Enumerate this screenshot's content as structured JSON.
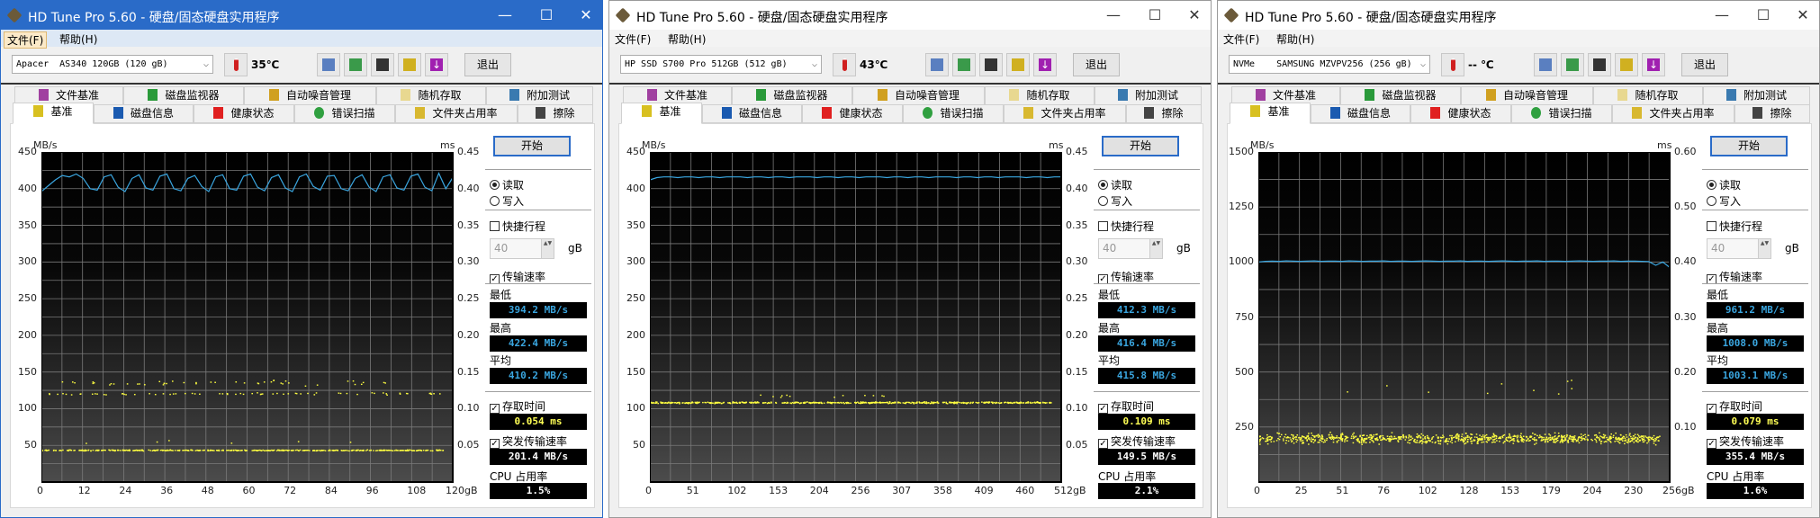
{
  "labels": {
    "menu": [
      "文件(F)",
      "帮助(H)"
    ],
    "exit": "退出",
    "tabs_row1": [
      "文件基准",
      "磁盘监视器",
      "自动噪音管理",
      "随机存取",
      "附加测试"
    ],
    "tabs_row2": [
      "基准",
      "磁盘信息",
      "健康状态",
      "错误扫描",
      "文件夹占用率",
      "擦除"
    ],
    "start": "开始",
    "read": "读取",
    "write": "写入",
    "short_stroke": "快捷行程",
    "short_stroke_value": "40",
    "short_stroke_unit": "gB",
    "transfer_rate": "传输速率",
    "minimum": "最低",
    "maximum": "最高",
    "average": "平均",
    "access_time": "存取时间",
    "burst_rate": "突发传输速率",
    "cpu_usage": "CPU 占用率",
    "y_left_unit": "MB/s",
    "y_right_unit": "ms",
    "window_controls": [
      "—",
      "☐",
      "✕"
    ]
  },
  "colors": {
    "transfer_line": "#3aa6e0",
    "access_points": "#ffff40",
    "title_active": "#2a6bc8"
  },
  "windows": [
    {
      "title": "HD Tune Pro 5.60 - 硬盘/固态硬盘实用程序",
      "active": true,
      "drive": "Apacer  AS340 120GB (120 gB)",
      "temperature": "35℃",
      "results": {
        "min": "394.2 MB/s",
        "max": "422.4 MB/s",
        "avg": "410.2 MB/s",
        "access": "0.054 ms",
        "burst": "201.4 MB/s",
        "cpu": "1.5%"
      }
    },
    {
      "title": "HD Tune Pro 5.60 - 硬盘/固态硬盘实用程序",
      "active": false,
      "drive": "HP SSD S700 Pro 512GB (512 gB)",
      "temperature": "43℃",
      "results": {
        "min": "412.3 MB/s",
        "max": "416.4 MB/s",
        "avg": "415.8 MB/s",
        "access": "0.109 ms",
        "burst": "149.5 MB/s",
        "cpu": "2.1%"
      }
    },
    {
      "title": "HD Tune Pro 5.60 - 硬盘/固态硬盘实用程序",
      "active": false,
      "drive": "NVMe    SAMSUNG MZVPV256 (256 gB)",
      "temperature": "-- ℃",
      "results": {
        "min": "961.2 MB/s",
        "max": "1008.0 MB/s",
        "avg": "1003.1 MB/s",
        "access": "0.079 ms",
        "burst": "355.4 MB/s",
        "cpu": "1.6%"
      }
    }
  ],
  "chart_data": [
    {
      "type": "line",
      "title": "Apacer AS340 120GB read benchmark",
      "ylabel": "MB/s",
      "y2label": "ms",
      "ylim": [
        0,
        450
      ],
      "y2lim": [
        0,
        0.45
      ],
      "xlim": [
        0,
        120
      ],
      "y_ticks": [
        "450",
        "400",
        "350",
        "300",
        "250",
        "200",
        "150",
        "100",
        "50"
      ],
      "y2_ticks": [
        "0.45",
        "0.40",
        "0.35",
        "0.30",
        "0.25",
        "0.20",
        "0.15",
        "0.10",
        "0.05"
      ],
      "x_ticks": [
        "0",
        "12",
        "24",
        "36",
        "48",
        "60",
        "72",
        "84",
        "96",
        "108",
        "120gB"
      ],
      "grid": true,
      "transfer_rate_mbps": [
        396,
        404,
        412,
        418,
        416,
        420,
        414,
        400,
        398,
        416,
        419,
        402,
        396,
        414,
        419,
        401,
        398,
        417,
        420,
        400,
        397,
        414,
        418,
        403,
        396,
        416,
        419,
        400,
        398,
        417,
        420,
        402,
        397,
        415,
        419,
        401,
        396,
        416,
        420,
        403,
        398,
        417,
        418,
        400,
        397,
        414,
        419,
        402,
        396,
        416,
        419,
        401,
        398,
        417,
        420,
        402,
        397,
        421,
        400,
        415
      ],
      "access_time_ms": [
        {
          "center": 0.044,
          "spread": 0.001,
          "count": 420,
          "x_from": 0,
          "x_to": 117
        },
        {
          "center": 0.121,
          "spread": 0.002,
          "count": 70,
          "x_from": 1,
          "x_to": 117
        },
        {
          "center": 0.136,
          "spread": 0.005,
          "count": 45,
          "x_from": 3,
          "x_to": 105
        },
        {
          "center": 0.055,
          "spread": 0.006,
          "count": 6,
          "x_from": 10,
          "x_to": 92
        }
      ]
    },
    {
      "type": "line",
      "title": "HP SSD S700 Pro 512GB read benchmark",
      "ylabel": "MB/s",
      "y2label": "ms",
      "ylim": [
        0,
        450
      ],
      "y2lim": [
        0,
        0.45
      ],
      "xlim": [
        0,
        512
      ],
      "y_ticks": [
        "450",
        "400",
        "350",
        "300",
        "250",
        "200",
        "150",
        "100",
        "50"
      ],
      "y2_ticks": [
        "0.45",
        "0.40",
        "0.35",
        "0.30",
        "0.25",
        "0.20",
        "0.15",
        "0.10",
        "0.05"
      ],
      "x_ticks": [
        "0",
        "51",
        "102",
        "153",
        "204",
        "256",
        "307",
        "358",
        "409",
        "460",
        "512gB"
      ],
      "grid": true,
      "transfer_rate_mbps": [
        412,
        415,
        416,
        416,
        415,
        416,
        416,
        415,
        416,
        416,
        415,
        416,
        416,
        416,
        415,
        416,
        416,
        415,
        416,
        416,
        415,
        416,
        416,
        416,
        415,
        416,
        416,
        415,
        416,
        416,
        415,
        416,
        416,
        416,
        415,
        416,
        416,
        415,
        416,
        416,
        415,
        416,
        416,
        416,
        415,
        416,
        416,
        415,
        416,
        416,
        415,
        416,
        416,
        416,
        415,
        416,
        416,
        415,
        416,
        416
      ],
      "access_time_ms": [
        {
          "center": 0.109,
          "spread": 0.0015,
          "count": 520,
          "x_from": 0,
          "x_to": 505
        },
        {
          "center": 0.118,
          "spread": 0.004,
          "count": 12,
          "x_from": 100,
          "x_to": 340
        }
      ]
    },
    {
      "type": "line",
      "title": "SAMSUNG MZVPV256 read benchmark",
      "ylabel": "MB/s",
      "y2label": "ms",
      "ylim": [
        0,
        1500
      ],
      "y2lim": [
        0,
        0.6
      ],
      "xlim": [
        0,
        256
      ],
      "y_ticks": [
        "1500",
        "1250",
        "1000",
        "750",
        "500",
        "250"
      ],
      "y2_ticks": [
        "0.60",
        "0.50",
        "0.40",
        "0.30",
        "0.20",
        "0.10"
      ],
      "x_ticks": [
        "0",
        "25",
        "51",
        "76",
        "102",
        "128",
        "153",
        "179",
        "204",
        "230",
        "256gB"
      ],
      "grid": true,
      "transfer_rate_mbps": [
        1000,
        1003,
        1004,
        1003,
        1005,
        1004,
        1003,
        1004,
        1005,
        1003,
        1004,
        1004,
        1003,
        1005,
        1004,
        1003,
        1004,
        1004,
        1005,
        1003,
        1004,
        1004,
        1003,
        1004,
        1005,
        1004,
        1003,
        1004,
        1004,
        1005,
        1003,
        1004,
        1004,
        1003,
        1004,
        1005,
        1004,
        1003,
        1004,
        1004,
        1005,
        1003,
        1004,
        1004,
        1003,
        1004,
        1005,
        1004,
        1003,
        1004,
        1004,
        1005,
        1003,
        1004,
        1004,
        1003,
        1002,
        985,
        1000,
        975
      ],
      "access_time_ms": [
        {
          "center": 0.08,
          "spread": 0.013,
          "count": 950,
          "x_from": 0,
          "x_to": 250
        },
        {
          "center": 0.17,
          "spread": 0.03,
          "count": 10,
          "x_from": 0,
          "x_to": 200
        }
      ]
    }
  ]
}
